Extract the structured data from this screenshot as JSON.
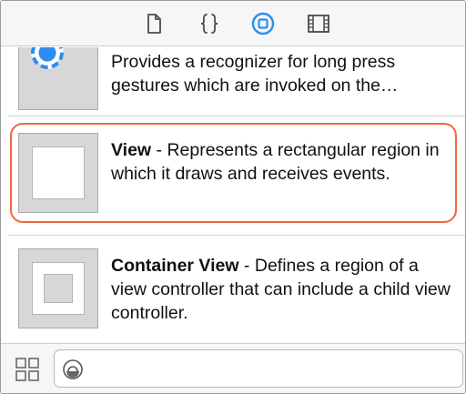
{
  "tabbar": {
    "tabs": [
      {
        "icon": "file-icon",
        "active": false
      },
      {
        "icon": "braces-icon",
        "active": false
      },
      {
        "icon": "object-library-icon",
        "active": true
      },
      {
        "icon": "media-library-icon",
        "active": false
      }
    ],
    "accent": "#2e8cf2"
  },
  "library": {
    "items": [
      {
        "name": "",
        "description": "Provides a recognizer for long press gestures which are invoked on the…",
        "icon": "long-press-gesture-icon"
      },
      {
        "name": "View",
        "separator": " - ",
        "description": "Represents a rectangular region in which it draws and receives events.",
        "icon": "view-icon",
        "highlighted": true
      },
      {
        "name": "Container View",
        "separator": " - ",
        "description": "Defines a region of a view controller that can include a child view controller.",
        "icon": "container-view-icon"
      }
    ],
    "highlight_color": "#ee6840"
  },
  "bottombar": {
    "filter_value": "",
    "grid_icon": "grid-view-icon",
    "filter_icon": "filter-icon"
  }
}
